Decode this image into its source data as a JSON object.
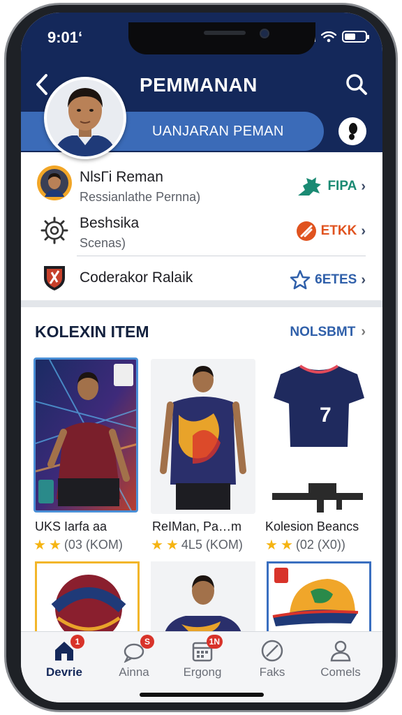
{
  "status": {
    "time": "9:01‘"
  },
  "header": {
    "title": "PEMMANAN",
    "pill_label": "UANJARAN PEMAN"
  },
  "profile_rows": [
    {
      "title": "NlsГi Reman",
      "subtitle": "Ressianlathe Pernna)",
      "link_label": "FIPA",
      "link_color": "#1a8a73"
    },
    {
      "title": "Beshsika",
      "subtitle": "Scenas)",
      "link_label": "ETKK",
      "link_color": "#e0531f"
    },
    {
      "title": "Coderakor Ralaik",
      "subtitle": "",
      "link_label": "6ETES",
      "link_color": "#3060aa"
    }
  ],
  "collection": {
    "title": "KOLEXIN ITEM",
    "see_all": "NOLSBMT",
    "items": [
      {
        "name": "UKS Iarfa aa",
        "rating": "(03  (KOM)",
        "stars": 2
      },
      {
        "name": "ReIMan, Pa…m",
        "rating": "4L5  (KOM)",
        "stars": 2
      },
      {
        "name": "Kolesion Beancs",
        "rating": "(02  (X0))",
        "stars": 2
      }
    ]
  },
  "tabs": [
    {
      "label": "Devrie",
      "badge": "1",
      "icon": "home-icon",
      "active": true
    },
    {
      "label": "Ainna",
      "badge": "S",
      "icon": "chat-icon",
      "active": false
    },
    {
      "label": "Ergong",
      "badge": "1N",
      "icon": "calendar-icon",
      "active": false
    },
    {
      "label": "Faks",
      "badge": "",
      "icon": "compass-icon",
      "active": false
    },
    {
      "label": "Comels",
      "badge": "",
      "icon": "user-icon",
      "active": false
    }
  ],
  "colors": {
    "header_bg": "#14285a",
    "pill_bg": "#3b6bb8",
    "badge_red": "#d8332a",
    "star": "#f5b412"
  }
}
